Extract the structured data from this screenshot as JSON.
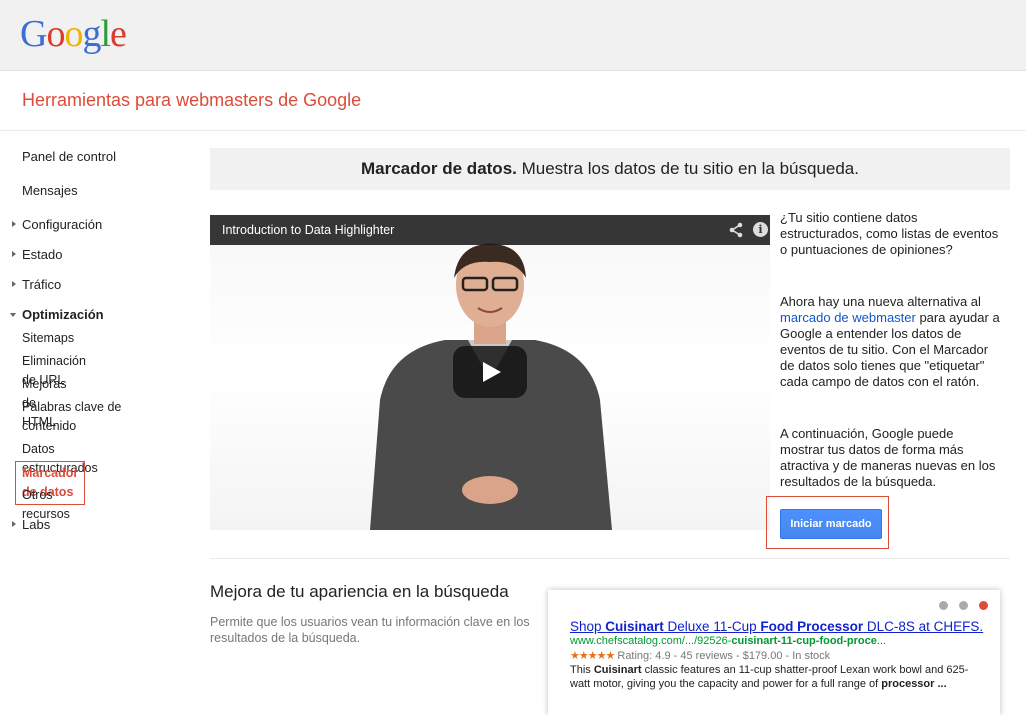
{
  "logo": {
    "letters": [
      "G",
      "o",
      "o",
      "g",
      "l",
      "e"
    ]
  },
  "app_title": "Herramientas para webmasters de Google",
  "sidebar": {
    "items": [
      {
        "label": "Panel de control"
      },
      {
        "label": "Mensajes"
      },
      {
        "label": "Configuración"
      },
      {
        "label": "Estado"
      },
      {
        "label": "Tráfico"
      },
      {
        "label": "Optimización"
      },
      {
        "label": "Labs"
      }
    ],
    "sub_items": [
      {
        "label": "Sitemaps"
      },
      {
        "label": "Eliminación de URL"
      },
      {
        "label": "Mejoras de HTML"
      },
      {
        "label": "Palabras clave de contenido"
      },
      {
        "label": "Datos estructurados"
      },
      {
        "label": "Marcador de datos"
      },
      {
        "label": "Otros recursos"
      }
    ]
  },
  "banner": {
    "bold": "Marcador de datos.",
    "rest": "Muestra los datos de tu sitio en la búsqueda."
  },
  "video": {
    "title": "Introduction to Data Highlighter",
    "info_glyph": "i"
  },
  "intro": {
    "p1": "¿Tu sitio contiene datos estructurados, como listas de eventos o puntuaciones de opiniones?",
    "p2_before": "Ahora hay una nueva alternativa al ",
    "p2_link": "marcado de webmaster",
    "p2_after": " para ayudar a Google a entender los datos de eventos de tu sitio. Con el Marcador de datos solo tienes que \"etiquetar\" cada campo de datos con el ratón.",
    "p3": "A continuación, Google puede mostrar tus datos de forma más atractiva y de maneras nuevas en los resultados de la búsqueda."
  },
  "cta": {
    "label": "Iniciar marcado"
  },
  "section": {
    "title": "Mejora de tu apariencia en la búsqueda",
    "description": "Permite que los usuarios vean tu información clave en los resultados de la búsqueda."
  },
  "preview": {
    "title_parts": [
      "Shop ",
      "Cuisinart",
      " Deluxe 11-Cup ",
      "Food Processor",
      " DLC-8S at CHEFS."
    ],
    "url_parts": [
      "www.chefscatalog.com/.../92526-",
      "cuisinart-11-cup-food-proce",
      "..."
    ],
    "stars": "★★★★★",
    "meta": " Rating: 4.9 - 45 reviews - $179.00 - In stock",
    "snippet_parts": [
      "This ",
      "Cuisinart",
      " classic features an 11-cup shatter-proof Lexan work bowl and 625-watt motor, giving you the capacity and power for a full range of ",
      "processor ...",
      ""
    ],
    "carousel_active_dot": 3
  },
  "colors": {
    "accent_red": "#dd4b39",
    "link_blue": "#1155cc",
    "button_blue": "#4d90fe"
  }
}
